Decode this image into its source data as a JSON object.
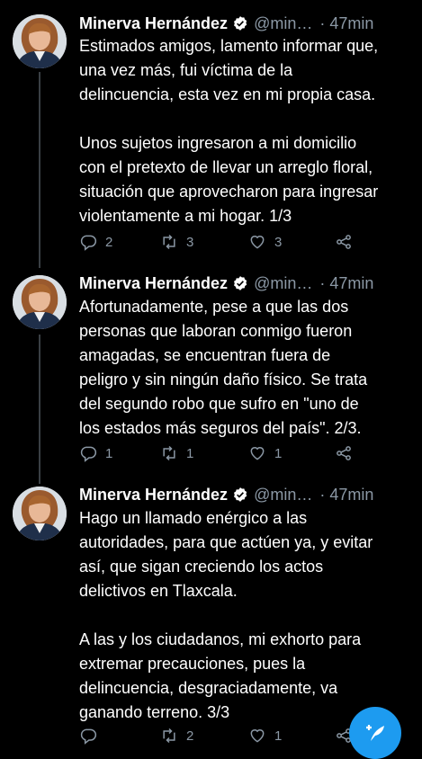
{
  "tweets": [
    {
      "name": "Minerva Hernández",
      "handle": "@min…",
      "time": "47min",
      "text": "Estimados amigos, lamento informar que,\nuna vez más, fui víctima de la\ndelincuencia, esta vez en mi propia casa.\n\nUnos sujetos ingresaron a mi domicilio\ncon el pretexto de llevar un arreglo floral,\nsituación que aprovecharon para ingresar\nviolentamente a mi hogar. 1/3",
      "replies": "2",
      "retweets": "3",
      "likes": "3"
    },
    {
      "name": "Minerva Hernández",
      "handle": "@min…",
      "time": "47min",
      "text": "Afortunadamente, pese a que las dos\npersonas que laboran conmigo fueron\namagadas, se encuentran fuera de\npeligro y sin ningún daño físico. Se trata\ndel segundo robo que sufro en \"uno de\nlos estados más seguros del país\". 2/3.",
      "replies": "1",
      "retweets": "1",
      "likes": "1"
    },
    {
      "name": "Minerva Hernández",
      "handle": "@min…",
      "time": "47min",
      "text": "Hago un llamado enérgico a las\nautoridades, para que actúen ya, y evitar\nasí, que sigan creciendo los actos\ndelictivos en Tlaxcala.\n\nA las y los ciudadanos, mi exhorto para\nextremar precauciones, pues la\ndelincuencia, desgraciadamente, va\nganando terreno. 3/3",
      "replies": "",
      "retweets": "2",
      "likes": "1"
    }
  ],
  "colors": {
    "background": "#000000",
    "text": "#ffffff",
    "secondary": "#8b98a5",
    "accent": "#1d9bf0"
  },
  "icons": {
    "reply": "reply-icon",
    "retweet": "retweet-icon",
    "like": "like-icon",
    "share": "share-icon",
    "verified": "verified-badge-icon",
    "compose": "compose-tweet-icon"
  }
}
